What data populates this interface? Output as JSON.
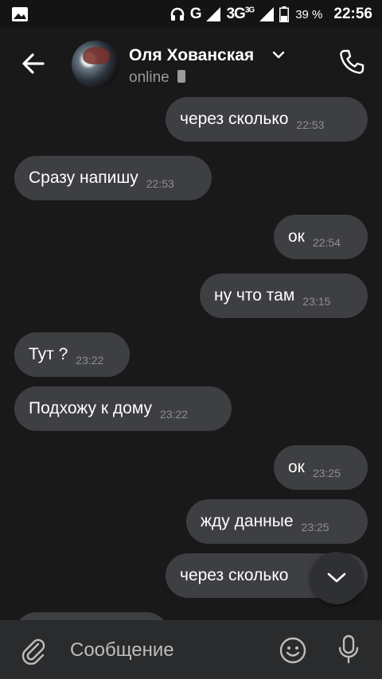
{
  "status_bar": {
    "network_g": "G",
    "network_3g": "3G",
    "network_3g_sup": "3G",
    "battery": "39 %",
    "time": "22:56"
  },
  "header": {
    "contact_name": "Оля Хованская",
    "status": "online"
  },
  "messages": [
    {
      "text": "через сколько",
      "time": "22:53",
      "side": "right"
    },
    {
      "text": "Сразу напишу",
      "time": "22:53",
      "side": "left"
    },
    {
      "text": "ок",
      "time": "22:54",
      "side": "right"
    },
    {
      "text": "ну что там",
      "time": "23:15",
      "side": "right"
    },
    {
      "text": "Тут ?",
      "time": "23:22",
      "side": "left"
    },
    {
      "text": "Подхожу к дому",
      "time": "23:22",
      "side": "left"
    },
    {
      "text": "ок",
      "time": "23:25",
      "side": "right"
    },
    {
      "text": "жду данные",
      "time": "23:25",
      "side": "right"
    },
    {
      "text": "через сколько",
      "time": "",
      "side": "right"
    }
  ],
  "composer": {
    "placeholder": "Сообщение"
  },
  "icons": {
    "back": "arrow-left-icon",
    "phone": "phone-icon",
    "attach": "paperclip-icon",
    "emoji": "smiley-icon",
    "mic": "microphone-icon",
    "scroll_down": "chevron-down-icon"
  },
  "colors": {
    "background": "#19191a",
    "bubble": "#3e3f42",
    "composer": "#2a2b2d",
    "timestamp": "#8d8e90"
  }
}
